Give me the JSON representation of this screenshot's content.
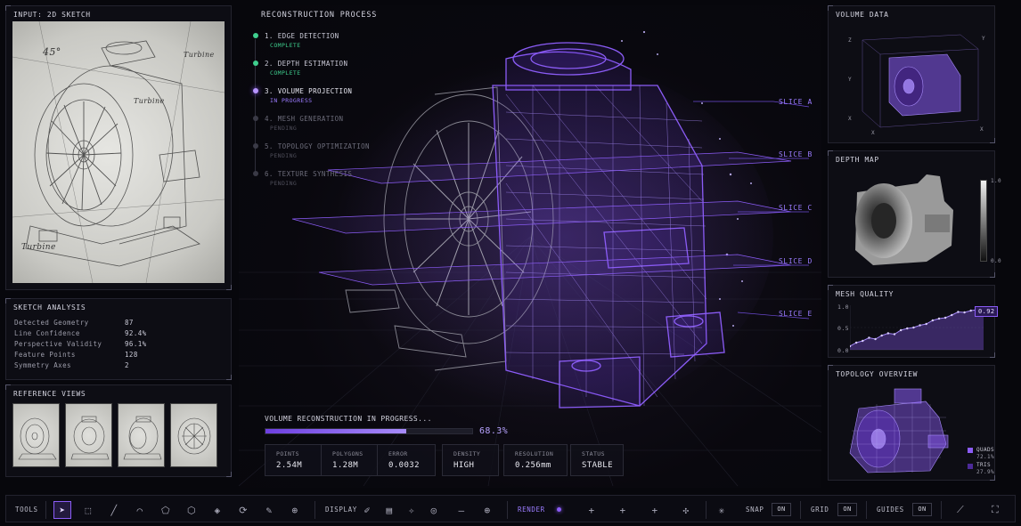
{
  "input_panel": {
    "title": "INPUT: 2D SKETCH",
    "notes": [
      "45°",
      "Turbine",
      "Turbine",
      "Turbine"
    ]
  },
  "sketch_analysis": {
    "title": "SKETCH ANALYSIS",
    "rows": [
      {
        "label": "Detected Geometry",
        "value": "87"
      },
      {
        "label": "Line Confidence",
        "value": "92.4%"
      },
      {
        "label": "Perspective Validity",
        "value": "96.1%"
      },
      {
        "label": "Feature Points",
        "value": "128"
      },
      {
        "label": "Symmetry Axes",
        "value": "2"
      }
    ]
  },
  "reference_views": {
    "title": "REFERENCE VIEWS"
  },
  "process": {
    "title": "RECONSTRUCTION PROCESS",
    "steps": [
      {
        "title": "1. EDGE DETECTION",
        "status": "COMPLETE",
        "state": "complete"
      },
      {
        "title": "2. DEPTH ESTIMATION",
        "status": "COMPLETE",
        "state": "complete"
      },
      {
        "title": "3. VOLUME PROJECTION",
        "status": "IN PROGRESS",
        "state": "active"
      },
      {
        "title": "4. MESH GENERATION",
        "status": "PENDING",
        "state": "pending"
      },
      {
        "title": "5. TOPOLOGY OPTIMIZATION",
        "status": "PENDING",
        "state": "pending"
      },
      {
        "title": "6. TEXTURE SYNTHESIS",
        "status": "PENDING",
        "state": "pending"
      }
    ]
  },
  "slices": [
    "SLICE A",
    "SLICE B",
    "SLICE C",
    "SLICE D",
    "SLICE E"
  ],
  "progress": {
    "label": "VOLUME RECONSTRUCTION IN PROGRESS...",
    "value_text": "68.3%",
    "fraction": 0.683
  },
  "stats": [
    {
      "label": "POINTS",
      "value": "2.54M"
    },
    {
      "label": "POLYGONS",
      "value": "1.28M"
    },
    {
      "label": "ERROR",
      "value": "0.0032"
    },
    {
      "label": "DENSITY",
      "value": "HIGH"
    },
    {
      "label": "RESOLUTION",
      "value": "0.256mm"
    },
    {
      "label": "STATUS",
      "value": "STABLE"
    }
  ],
  "volume_data": {
    "title": "VOLUME DATA",
    "axes": [
      "Z",
      "Y",
      "X",
      "X",
      "Y",
      "X"
    ]
  },
  "depth_map": {
    "title": "DEPTH MAP",
    "scale_max": "1.0",
    "scale_min": "0.0"
  },
  "mesh_quality": {
    "title": "MESH QUALITY",
    "current": "0.92",
    "ticks": [
      "1.0",
      "0.5",
      "0.0"
    ]
  },
  "chart_data": {
    "type": "line",
    "title": "MESH QUALITY",
    "ylim": [
      0,
      1
    ],
    "y_ticks": [
      "1.0",
      "0.5",
      "0.0"
    ],
    "values": [
      0.08,
      0.16,
      0.2,
      0.27,
      0.24,
      0.32,
      0.37,
      0.35,
      0.44,
      0.48,
      0.5,
      0.55,
      0.58,
      0.66,
      0.7,
      0.72,
      0.78,
      0.85,
      0.84,
      0.88,
      0.9,
      0.92
    ],
    "annotation": "0.92"
  },
  "topology": {
    "title": "TOPOLOGY OVERVIEW",
    "legend": [
      {
        "label": "QUADS",
        "value": "72.1%",
        "color": "#8b5cf6"
      },
      {
        "label": "TRIS",
        "value": "27.9%",
        "color": "#4c2a99"
      }
    ]
  },
  "toolbar": {
    "tools_label": "TOOLS",
    "display_label": "DISPLAY",
    "render_label": "RENDER",
    "snap_label": "SNAP",
    "snap_value": "ON",
    "grid_label": "GRID",
    "grid_value": "ON",
    "guides_label": "GUIDES",
    "guides_value": "ON"
  },
  "colors": {
    "accent": "#8b5cf6",
    "complete": "#3fcf8e",
    "bg": "#07070c"
  }
}
